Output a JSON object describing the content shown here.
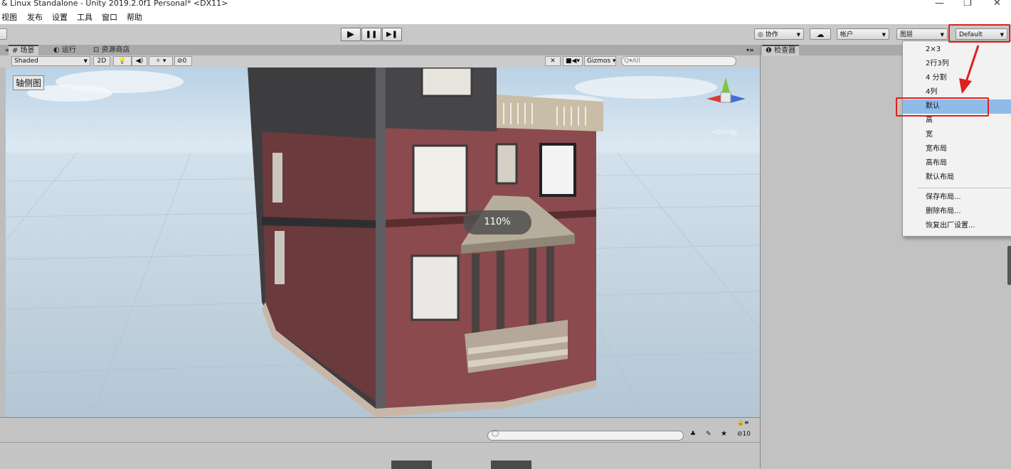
{
  "window": {
    "title": "& Linux Standalone - Unity 2019.2.0f1 Personal* <DX11>",
    "minimize": "—",
    "maximize": "❐",
    "close": "✕"
  },
  "menu": [
    "视图",
    "发布",
    "设置",
    "工具",
    "窗口",
    "帮助"
  ],
  "toolbar": {
    "play": "▶",
    "pause": "❚❚",
    "step": "▶❚",
    "collab": "◎ 协作",
    "account": "帐户",
    "layers": "图层",
    "layout": "Default"
  },
  "tabs": {
    "scene": "# 场景",
    "game": "◐ 运行",
    "asset_store": "⊡ 资源商店",
    "inspector": "❶ 检查器"
  },
  "scene_toolbar": {
    "shading": "Shaded",
    "mode_2d": "2D",
    "hidden_count": "0",
    "gizmos": "Gizmos",
    "search_placeholder": "Q▾All"
  },
  "scene_view": {
    "view_label": "轴侧图",
    "persp_label": "<Persp",
    "zoom": "110%"
  },
  "layout_menu": {
    "items": [
      "2×3",
      "2行3列",
      "4 分割",
      "4列",
      "默认",
      "高",
      "宽",
      "宽布局",
      "高布局",
      "默认布局"
    ],
    "actions": [
      "保存布局...",
      "删除布局...",
      "恢复出厂设置..."
    ],
    "selected": "默认"
  },
  "project_bar": {
    "count": "10"
  },
  "colors": {
    "highlight": "#e02020",
    "selected": "#8fbbe8",
    "wall": "#8a4a4e"
  }
}
